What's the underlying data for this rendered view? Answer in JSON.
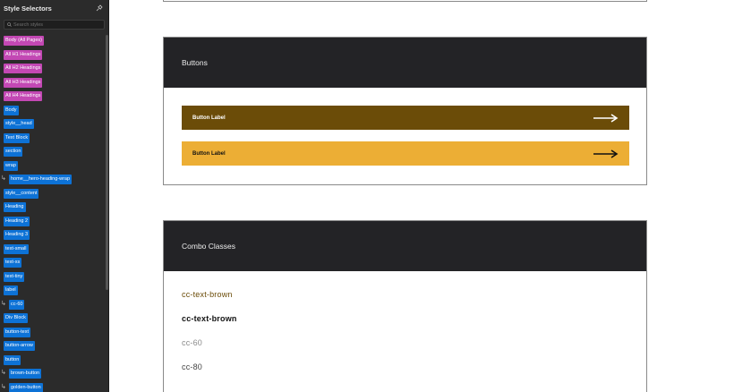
{
  "sidebar": {
    "title": "Style Selectors",
    "search": {
      "placeholder": "Search styles"
    },
    "items": [
      {
        "label": "Body (All Pages)",
        "color": "pink",
        "combo": false
      },
      {
        "label": "All H1 Headings",
        "color": "pink",
        "combo": false
      },
      {
        "label": "All H2 Headings",
        "color": "pink",
        "combo": false
      },
      {
        "label": "All H3 Headings",
        "color": "pink",
        "combo": false
      },
      {
        "label": "All H4 Headings",
        "color": "pink",
        "combo": false
      },
      {
        "label": "Body",
        "color": "blue",
        "combo": false
      },
      {
        "label": "style__head",
        "color": "blue",
        "combo": false
      },
      {
        "label": "Text Block",
        "color": "blue",
        "combo": false
      },
      {
        "label": "section",
        "color": "blue",
        "combo": false
      },
      {
        "label": "wrap",
        "color": "blue",
        "combo": false
      },
      {
        "label": "home__hero-heading-wrap",
        "color": "blue",
        "combo": true
      },
      {
        "label": "style__content",
        "color": "blue",
        "combo": false
      },
      {
        "label": "Heading",
        "color": "blue",
        "combo": false
      },
      {
        "label": "Heading 2",
        "color": "blue",
        "combo": false
      },
      {
        "label": "Heading 3",
        "color": "blue",
        "combo": false
      },
      {
        "label": "text-small",
        "color": "blue",
        "combo": false
      },
      {
        "label": "text-xs",
        "color": "blue",
        "combo": false
      },
      {
        "label": "text-tiny",
        "color": "blue",
        "combo": false
      },
      {
        "label": "label",
        "color": "blue",
        "combo": false
      },
      {
        "label": "cc-60",
        "color": "blue",
        "combo": true
      },
      {
        "label": "Div Block",
        "color": "blue",
        "combo": false
      },
      {
        "label": "button-text",
        "color": "blue",
        "combo": false
      },
      {
        "label": "button-arrow",
        "color": "blue",
        "combo": false
      },
      {
        "label": "button",
        "color": "blue",
        "combo": false
      },
      {
        "label": "brown-button",
        "color": "blue",
        "combo": true
      },
      {
        "label": "golden-button",
        "color": "blue",
        "combo": true
      }
    ]
  },
  "buttons_section": {
    "title": "Buttons",
    "brown_button_label": "Button Label",
    "golden_button_label": "Button Label"
  },
  "combo_section": {
    "title": "Combo Classes",
    "lines": [
      {
        "text": "cc-text-brown",
        "color": "#6b4c08",
        "weight": "normal"
      },
      {
        "text": "cc-text-brown",
        "color": "#111111",
        "weight": "bold"
      },
      {
        "text": "cc-60",
        "color": "#8a8a8a",
        "weight": "normal"
      },
      {
        "text": "cc-80",
        "color": "#444444",
        "weight": "normal"
      }
    ]
  },
  "colors": {
    "pink_tag": "#c348b4",
    "blue_tag": "#0d72d6",
    "brown": "#6b4c08",
    "golden": "#ecae35",
    "card_header": "#232326"
  }
}
